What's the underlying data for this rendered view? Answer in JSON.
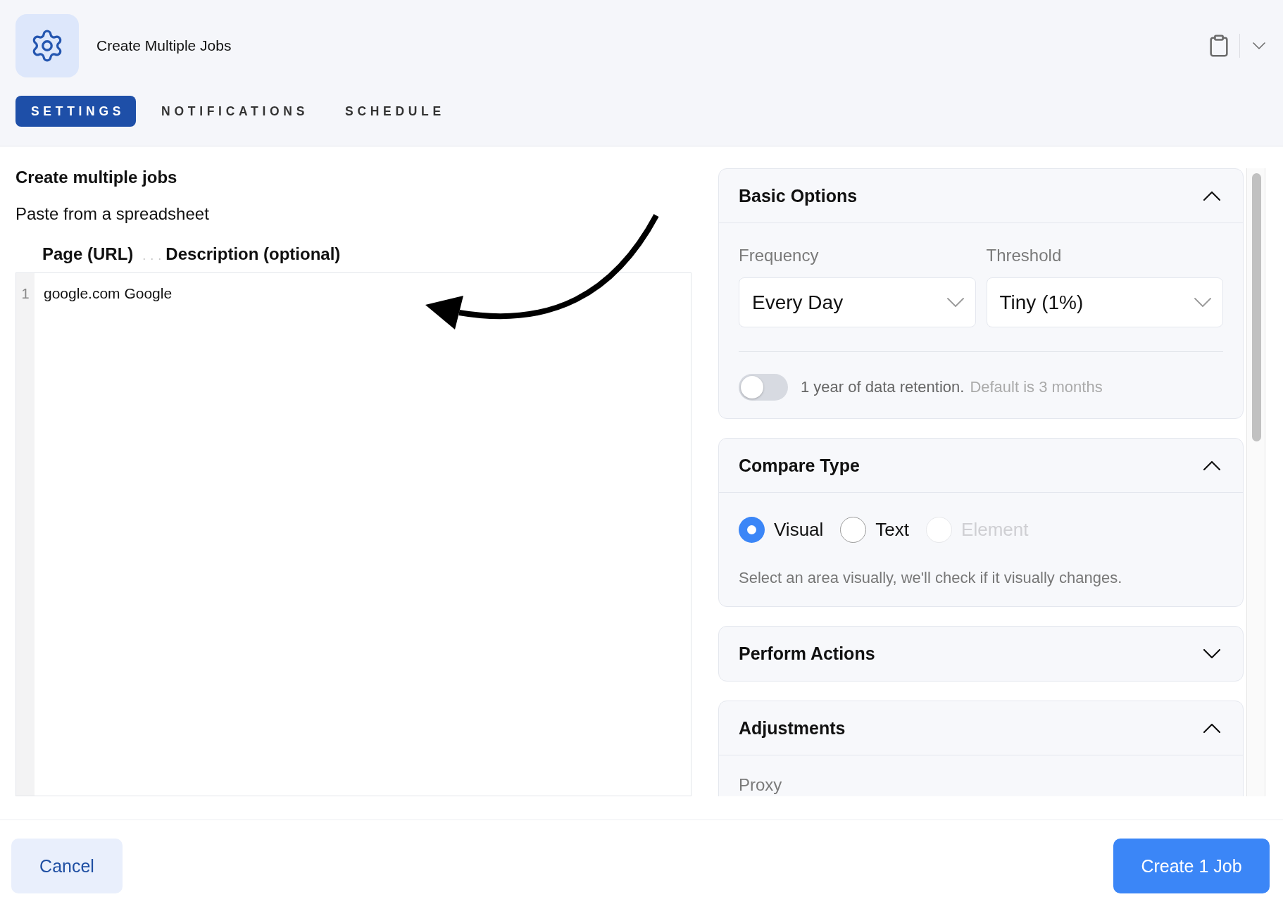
{
  "header": {
    "title": "Create Multiple Jobs"
  },
  "tabs": [
    {
      "label": "SETTINGS",
      "selected": true
    },
    {
      "label": "NOTIFICATIONS",
      "selected": false
    },
    {
      "label": "SCHEDULE",
      "selected": false
    }
  ],
  "editor": {
    "heading": "Create multiple jobs",
    "subheading": "Paste from a spreadsheet",
    "columns": [
      "Page (URL)",
      "Description (optional)"
    ],
    "separator": "...",
    "lines": [
      {
        "number": "1",
        "text": "google.com Google"
      }
    ]
  },
  "panels": [
    {
      "kind": "basic",
      "title": "Basic Options",
      "expanded": true,
      "fields": [
        {
          "label": "Frequency",
          "value": "Every Day"
        },
        {
          "label": "Threshold",
          "value": "Tiny (1%)"
        }
      ],
      "retention": {
        "on": false,
        "label": "1 year of data retention.",
        "note": "Default is 3 months"
      }
    },
    {
      "kind": "compare",
      "title": "Compare Type",
      "expanded": true,
      "options": [
        {
          "label": "Visual",
          "selected": true,
          "disabled": false
        },
        {
          "label": "Text",
          "selected": false,
          "disabled": false
        },
        {
          "label": "Element",
          "selected": false,
          "disabled": true
        }
      ],
      "description": "Select an area visually, we'll check if it visually changes."
    },
    {
      "kind": "actions",
      "title": "Perform Actions",
      "expanded": false
    },
    {
      "kind": "adjustments",
      "title": "Adjustments",
      "expanded": true,
      "fields": [
        {
          "label": "Proxy"
        }
      ]
    }
  ],
  "footer": {
    "cancel": "Cancel",
    "submit": "Create 1 Job"
  }
}
